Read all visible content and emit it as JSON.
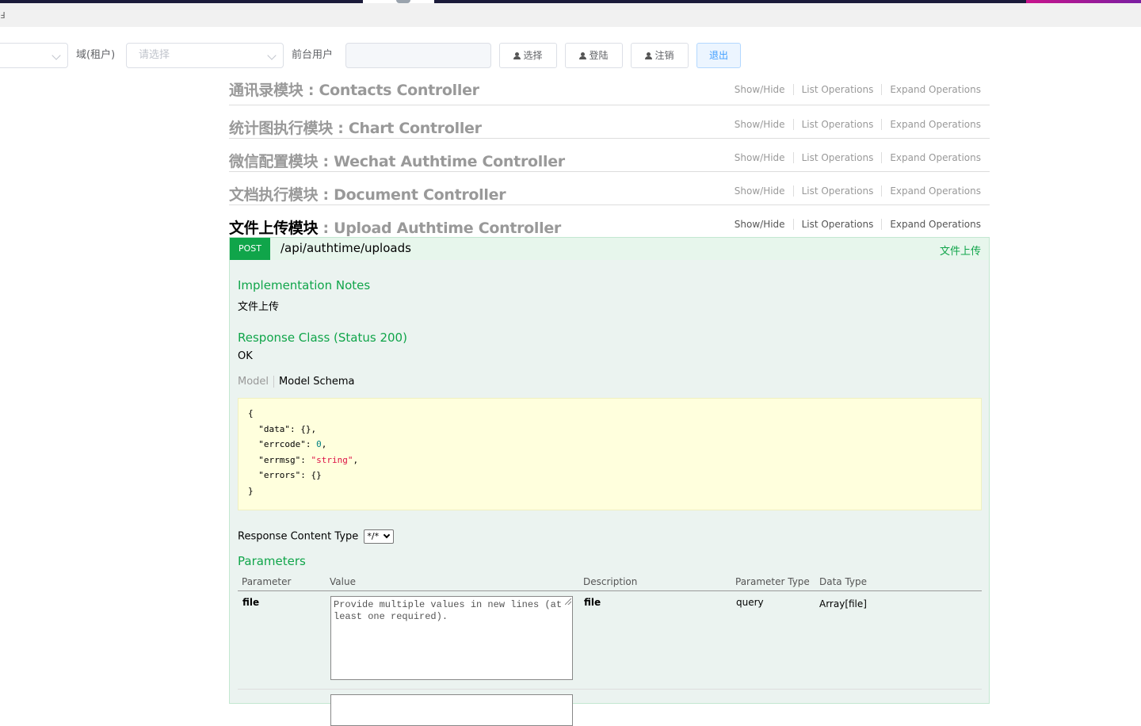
{
  "browser": {
    "fragment": "Ⅎ"
  },
  "toolbar": {
    "first_select_value": "",
    "domain_label": "域(租户)",
    "domain_placeholder": "请选择",
    "frontend_user_label": "前台用户",
    "frontend_user_value": "",
    "select_label": "选择",
    "login_label": "登陆",
    "logout_account_label": "注销",
    "exit_label": "退出"
  },
  "colors": {
    "post": "#10a54a",
    "accent": "#409eff",
    "schema_bg": "#ffffdd",
    "operation_bg": "#ebf3f0"
  },
  "resources": [
    {
      "cn": "通讯录模块",
      "en": " : Contacts Controller",
      "active": false
    },
    {
      "cn": "统计图执行模块",
      "en": " : Chart Controller",
      "active": false
    },
    {
      "cn": "微信配置模块",
      "en": " : Wechat Authtime Controller",
      "active": false
    },
    {
      "cn": "文档执行模块",
      "en": " : Document Controller",
      "active": false
    },
    {
      "cn": "文件上传模块",
      "en": " : Upload Authtime Controller",
      "active": true
    }
  ],
  "resource_ops": {
    "show_hide": "Show/Hide",
    "list": "List Operations",
    "expand": "Expand Operations"
  },
  "operation": {
    "method": "POST",
    "path": "/api/authtime/uploads",
    "summary": "文件上传",
    "impl_notes_title": "Implementation Notes",
    "impl_notes": "文件上传",
    "response_class_title": "Response Class (Status 200)",
    "response_class": "OK",
    "model_tab": "Model",
    "model_schema_tab": "Model Schema",
    "schema_lines": [
      "{",
      "  \"data\": {},",
      "  \"errcode\": 0,",
      "  \"errmsg\": \"string\",",
      "  \"errors\": {}",
      "}"
    ],
    "response_content_type_label": "Response Content Type",
    "response_content_type_value": "*/*",
    "parameters_title": "Parameters",
    "param_headers": [
      "Parameter",
      "Value",
      "Description",
      "Parameter Type",
      "Data Type"
    ],
    "params": [
      {
        "name": "file",
        "placeholder": "Provide multiple values in new lines (at least one required).",
        "description": "file",
        "param_type": "query",
        "data_type": "Array[file]"
      }
    ]
  }
}
